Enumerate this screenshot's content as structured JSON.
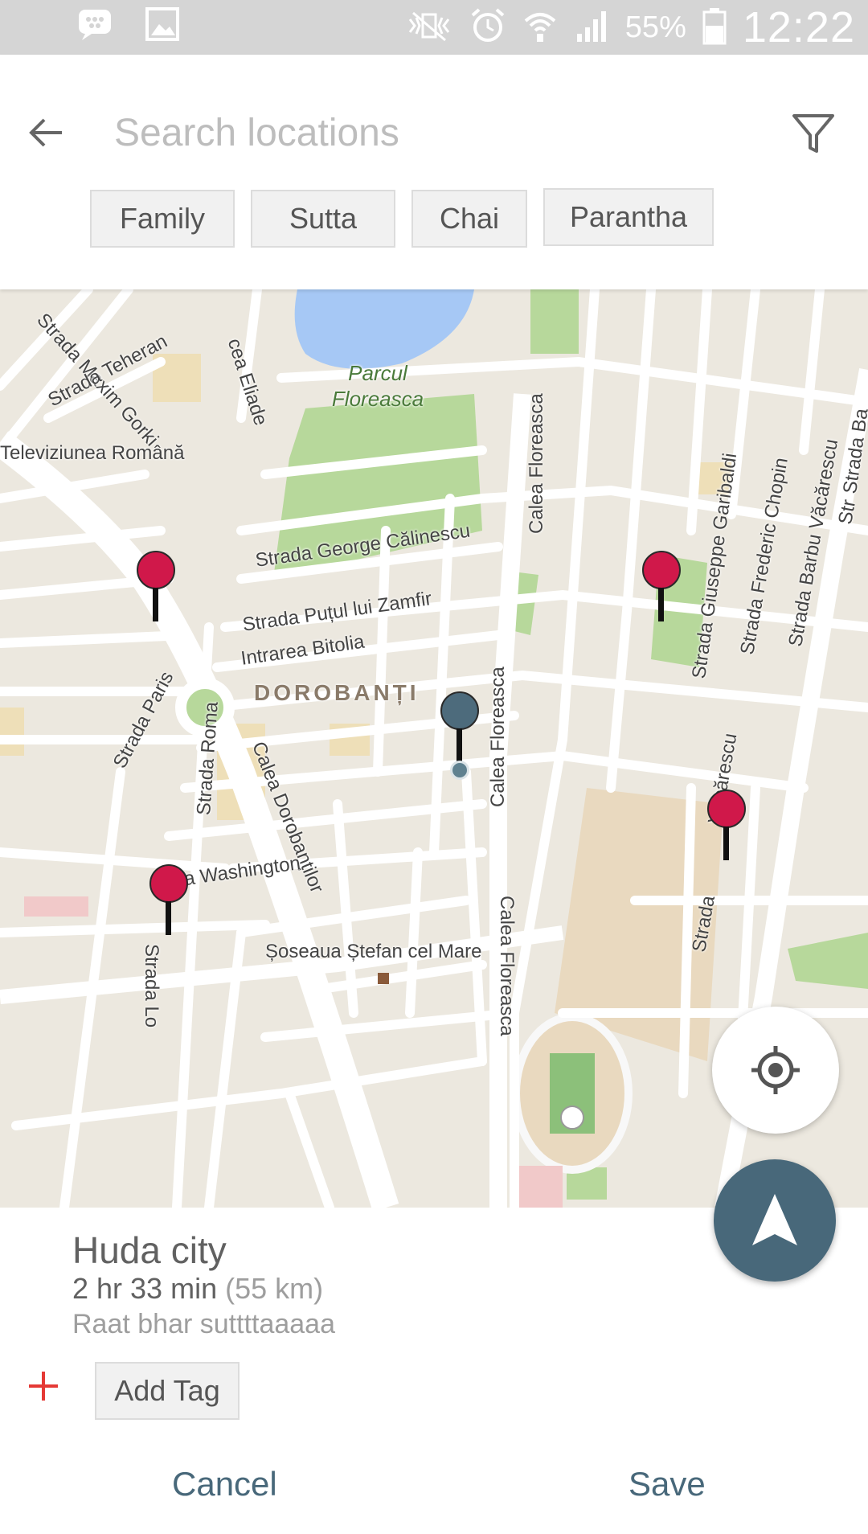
{
  "status_bar": {
    "battery_percent": "55%",
    "time": "12:22",
    "icons": [
      "bbm-icon",
      "gallery-icon",
      "mute-vibrate-icon",
      "alarm-icon",
      "wifi-icon",
      "signal-icon",
      "battery-icon"
    ]
  },
  "search": {
    "placeholder": "Search locations",
    "value": ""
  },
  "tags": [
    "Family",
    "Sutta",
    "Chai",
    "Parantha"
  ],
  "map": {
    "labels": {
      "maxim": "Strada Maxim Gorki",
      "eliade": "cea Eliade",
      "teheran": "Strada Teheran",
      "televiziunea": "Televiziunea Română",
      "park": "Parcul Floreasca",
      "calea_floreasca_1": "Calea Floreasca",
      "calea_floreasca_2": "Calea Floreasca",
      "calea_floreasca_3": "Calea Floreasca",
      "garibaldi": "Strada Giuseppe Garibaldi",
      "chopin": "Strada Frederic Chopin",
      "strada_right": "Strada Ba",
      "calinescu": "Strada George Călinescu",
      "putul": "Strada Puțul lui Zamfir",
      "bitolia": "Intrarea Bitolia",
      "vacarescu": "Strada Barbu Văcărescu",
      "dorobanti": "DOROBANȚI",
      "paris": "Strada Paris",
      "roma": "Strada Roma",
      "calea_dorobantilor": "Calea Dorobanților",
      "washington": "da Washington",
      "stefan": "Șoseaua Ștefan cel Mare",
      "lo": "Strada Lo",
      "vacarescu_2": "Văcărescu",
      "strada_bottom": "Strada",
      "str_edge": "Str"
    },
    "colors": {
      "pin": "#d0184a",
      "user_pin": "#4d6b7c",
      "park": "#b7d89b",
      "water": "#a6c8f5"
    }
  },
  "place": {
    "name": "Huda city",
    "duration": "2 hr 33 min",
    "distance": "(55 km)",
    "note": "Raat bhar suttttaaaaa"
  },
  "add_tag_label": "Add Tag",
  "actions": {
    "cancel": "Cancel",
    "save": "Save"
  },
  "theme": {
    "accent": "#48687a",
    "plus": "#e53935"
  }
}
